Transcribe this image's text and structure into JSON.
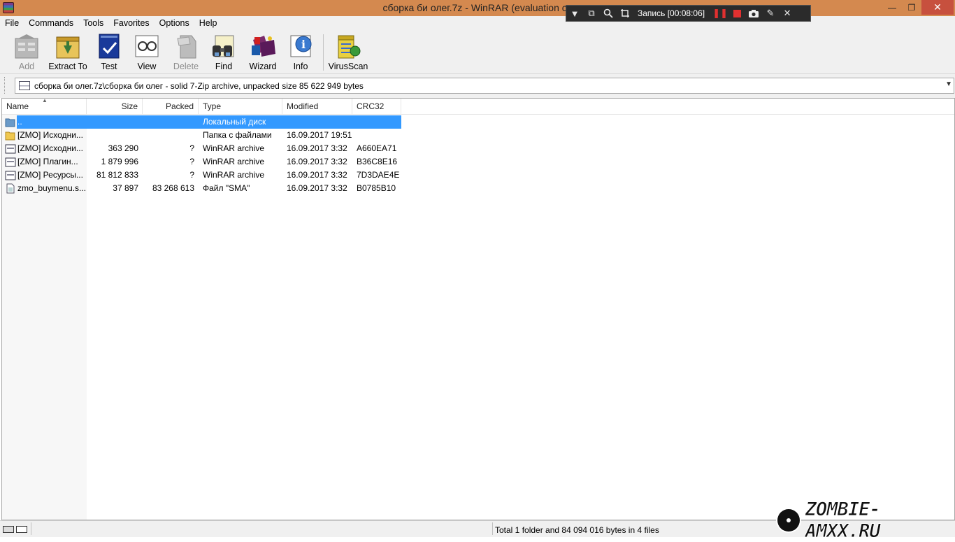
{
  "window": {
    "title": "сборка би олег.7z - WinRAR (evaluation co",
    "minimize": "—",
    "maximize": "❐",
    "close": "✕"
  },
  "recorder": {
    "label": "Запись [00:08:06]"
  },
  "menu": [
    "File",
    "Commands",
    "Tools",
    "Favorites",
    "Options",
    "Help"
  ],
  "toolbar": {
    "buttons": [
      {
        "label": "Add",
        "icon": "add-icon",
        "disabled": true
      },
      {
        "label": "Extract To",
        "icon": "extract-icon",
        "disabled": false
      },
      {
        "label": "Test",
        "icon": "test-icon",
        "disabled": false
      },
      {
        "label": "View",
        "icon": "view-icon",
        "disabled": false
      },
      {
        "label": "Delete",
        "icon": "delete-icon",
        "disabled": true
      },
      {
        "label": "Find",
        "icon": "find-icon",
        "disabled": false
      },
      {
        "label": "Wizard",
        "icon": "wizard-icon",
        "disabled": false
      },
      {
        "label": "Info",
        "icon": "info-icon",
        "disabled": false
      },
      {
        "label": "VirusScan",
        "icon": "virusscan-icon",
        "disabled": false
      }
    ]
  },
  "address": {
    "path": "сборка би олег.7z\\сборка би олег - solid 7-Zip archive, unpacked size 85 622 949 bytes"
  },
  "columns": {
    "name": "Name",
    "size": "Size",
    "packed": "Packed",
    "type": "Type",
    "modified": "Modified",
    "crc": "CRC32"
  },
  "rows": [
    {
      "name": "..",
      "size": "",
      "packed": "",
      "type": "Локальный диск",
      "modified": "",
      "crc": "",
      "icon": "up-folder-icon",
      "selected": true
    },
    {
      "name": "[ZMO] Исходни...",
      "size": "",
      "packed": "",
      "type": "Папка с файлами",
      "modified": "16.09.2017 19:51",
      "crc": "",
      "icon": "folder-icon",
      "selected": false
    },
    {
      "name": "[ZMO] Исходни...",
      "size": "363 290",
      "packed": "?",
      "type": "WinRAR archive",
      "modified": "16.09.2017 3:32",
      "crc": "A660EA71",
      "icon": "archive-icon",
      "selected": false
    },
    {
      "name": "[ZMO] Плагин...",
      "size": "1 879 996",
      "packed": "?",
      "type": "WinRAR archive",
      "modified": "16.09.2017 3:32",
      "crc": "B36C8E16",
      "icon": "archive-icon",
      "selected": false
    },
    {
      "name": "[ZMO] Ресурсы...",
      "size": "81 812 833",
      "packed": "?",
      "type": "WinRAR archive",
      "modified": "16.09.2017 3:32",
      "crc": "7D3DAE4E",
      "icon": "archive-icon",
      "selected": false
    },
    {
      "name": "zmo_buymenu.s...",
      "size": "37 897",
      "packed": "83 268 613",
      "type": "Файл \"SMA\"",
      "modified": "16.09.2017 3:32",
      "crc": "B0785B10",
      "icon": "file-icon",
      "selected": false
    }
  ],
  "status": {
    "summary": "Total 1 folder and 84 094 016 bytes in 4 files"
  },
  "watermark": {
    "text": "ZOMBIE-AMXX.RU"
  }
}
